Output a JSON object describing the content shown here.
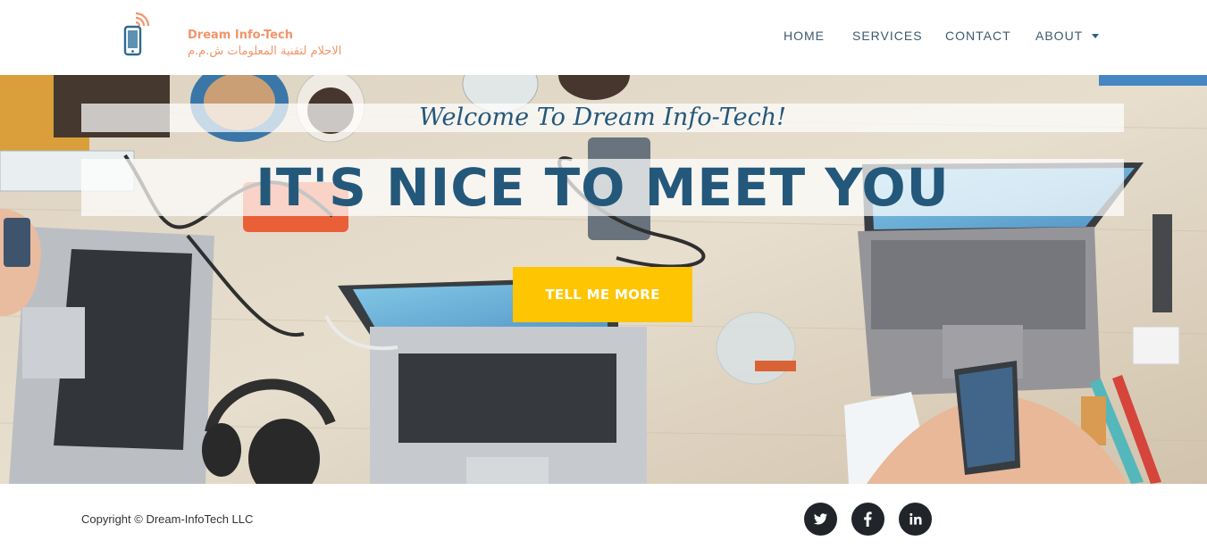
{
  "brand": {
    "name": "Dream Info-Tech",
    "subtitle": "الاحلام لتقنية المعلومات ش.م.م",
    "logo_icon": "mobile-phone-signal-icon",
    "color": "#f0956a"
  },
  "nav": {
    "items": [
      {
        "label": "HOME"
      },
      {
        "label": "SERVICES"
      },
      {
        "label": "CONTACT"
      },
      {
        "label": "ABOUT",
        "has_dropdown": true,
        "icon": "caret-down-icon"
      }
    ]
  },
  "hero": {
    "welcome": "Welcome To Dream Info-Tech!",
    "headline": "IT'S NICE TO MEET YOU",
    "cta_label": "TELL ME MORE",
    "background": "workspace-desk-photo",
    "text_color": "#24587b",
    "cta_color": "#fec503"
  },
  "footer": {
    "copyright": "Copyright © Dream-InfoTech LLC",
    "social": [
      {
        "network": "Twitter",
        "icon": "twitter-icon"
      },
      {
        "network": "Facebook",
        "icon": "facebook-icon"
      },
      {
        "network": "LinkedIn",
        "icon": "linkedin-icon"
      }
    ],
    "social_bg": "#212529"
  }
}
